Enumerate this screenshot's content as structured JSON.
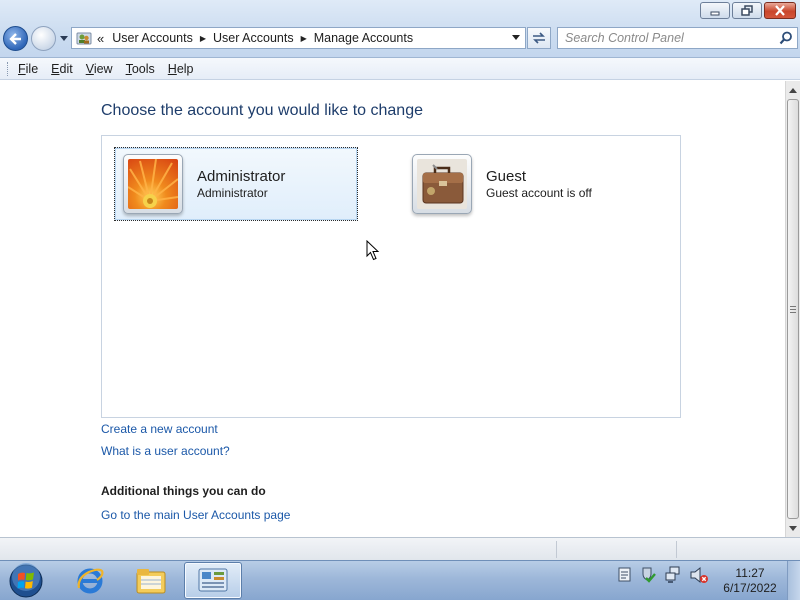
{
  "window": {
    "breadcrumbs": [
      "User Accounts",
      "User Accounts",
      "Manage Accounts"
    ],
    "search_placeholder": "Search Control Panel"
  },
  "menu": [
    "File",
    "Edit",
    "View",
    "Tools",
    "Help"
  ],
  "main": {
    "title": "Choose the account you would like to change",
    "accounts": [
      {
        "name": "Administrator",
        "subtitle": "Administrator",
        "picture": "orange-flower-picture",
        "selected": true
      },
      {
        "name": "Guest",
        "subtitle": "Guest account is off",
        "picture": "briefcase-picture",
        "selected": false
      }
    ],
    "links": {
      "create": "Create a new account",
      "what_is": "What is a user account?"
    },
    "additional": {
      "heading": "Additional things you can do",
      "main_page_link": "Go to the main User Accounts page"
    }
  },
  "taskbar": {
    "apps": [
      "internet-explorer-icon",
      "windows-explorer-icon",
      "control-panel-icon"
    ],
    "tray": [
      "action-center-icon",
      "security-shield-icon",
      "network-icon",
      "volume-muted-icon"
    ],
    "time": "11:27",
    "date": "6/17/2022"
  },
  "colors": {
    "title_text": "#1e3d6b",
    "link": "#1b58a8",
    "selection_bg": "#e0eefb"
  }
}
